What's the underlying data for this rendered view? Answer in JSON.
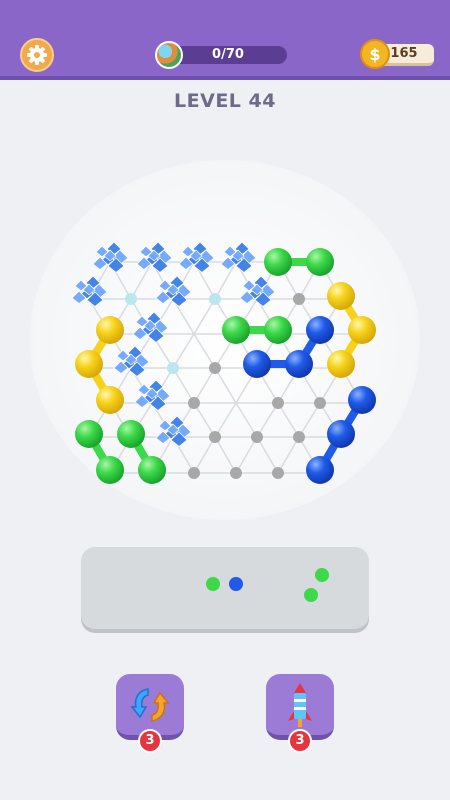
{
  "header": {
    "progress_text": "0/70",
    "progress_fraction": 0.0,
    "coins": "165",
    "coin_symbol": "$"
  },
  "level": {
    "title": "LEVEL 44"
  },
  "colors": {
    "green": "#3dd94a",
    "yellow": "#f6d31a",
    "blue": "#1f5be8",
    "ice": "#3b7ee8",
    "node": "#a8a8a8",
    "purple": "#8a66c8"
  },
  "tray": {
    "balls": [
      "green",
      "blue",
      "green",
      "green"
    ]
  },
  "powerups": [
    {
      "icon": "swap-arrows-icon",
      "count": "3"
    },
    {
      "icon": "rocket-icon",
      "count": "3"
    }
  ]
}
